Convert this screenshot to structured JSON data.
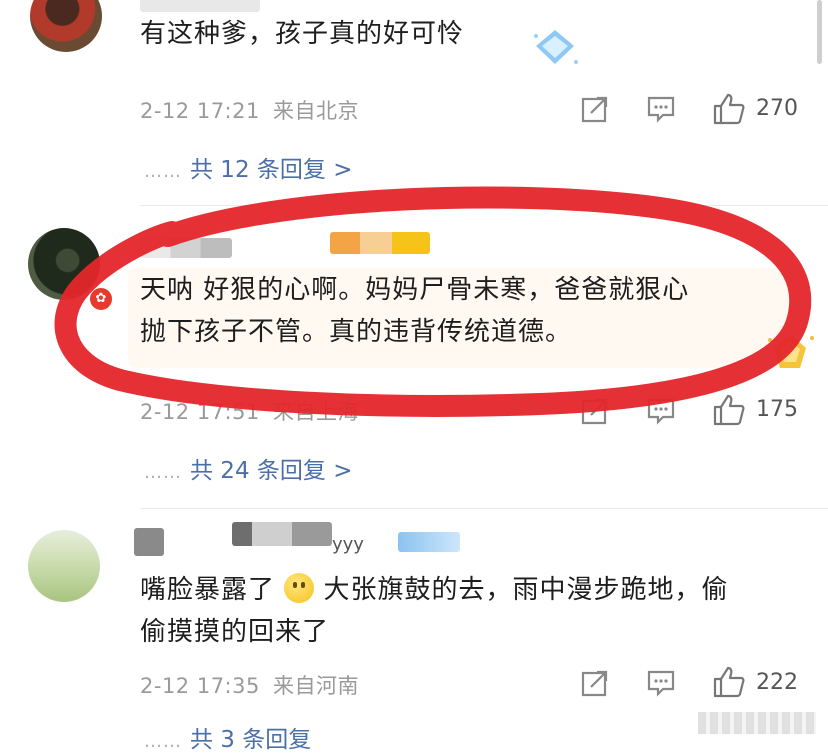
{
  "comments": [
    {
      "text": "有这种爹，孩子真的好可怜",
      "time": "2-12 17:21",
      "location": "来自北京",
      "likes": "270",
      "replies": "共 12 条回复 >"
    },
    {
      "text_line1": "天呐 好狠的心啊。妈妈尸骨未寒，爸爸就狠心",
      "text_line2": "抛下孩子不管。真的违背传统道德。",
      "time": "2-12 17:51",
      "location": "来自上海",
      "likes": "175",
      "replies": "共 24 条回复 >",
      "avatar_badge": "✿"
    },
    {
      "username_partial": "yyy",
      "text_line1_a": "嘴脸暴露了",
      "text_line1_b": "大张旗鼓的去，雨中漫步跪地，偷",
      "text_line2": "偷摸摸的回来了",
      "time": "2-12 17:35",
      "location": "来自河南",
      "likes": "222",
      "replies": "共 3 条回复"
    }
  ],
  "reply_dots": "……",
  "icons": [
    "repost-icon",
    "comment-icon",
    "like-icon",
    "diamond-badge-icon",
    "medal-badge-icon",
    "smile-emoji-icon"
  ],
  "colors": {
    "annotation_red": "#e4262a",
    "reply_link": "#4c6fa8",
    "meta_gray": "#9a9a9a"
  }
}
